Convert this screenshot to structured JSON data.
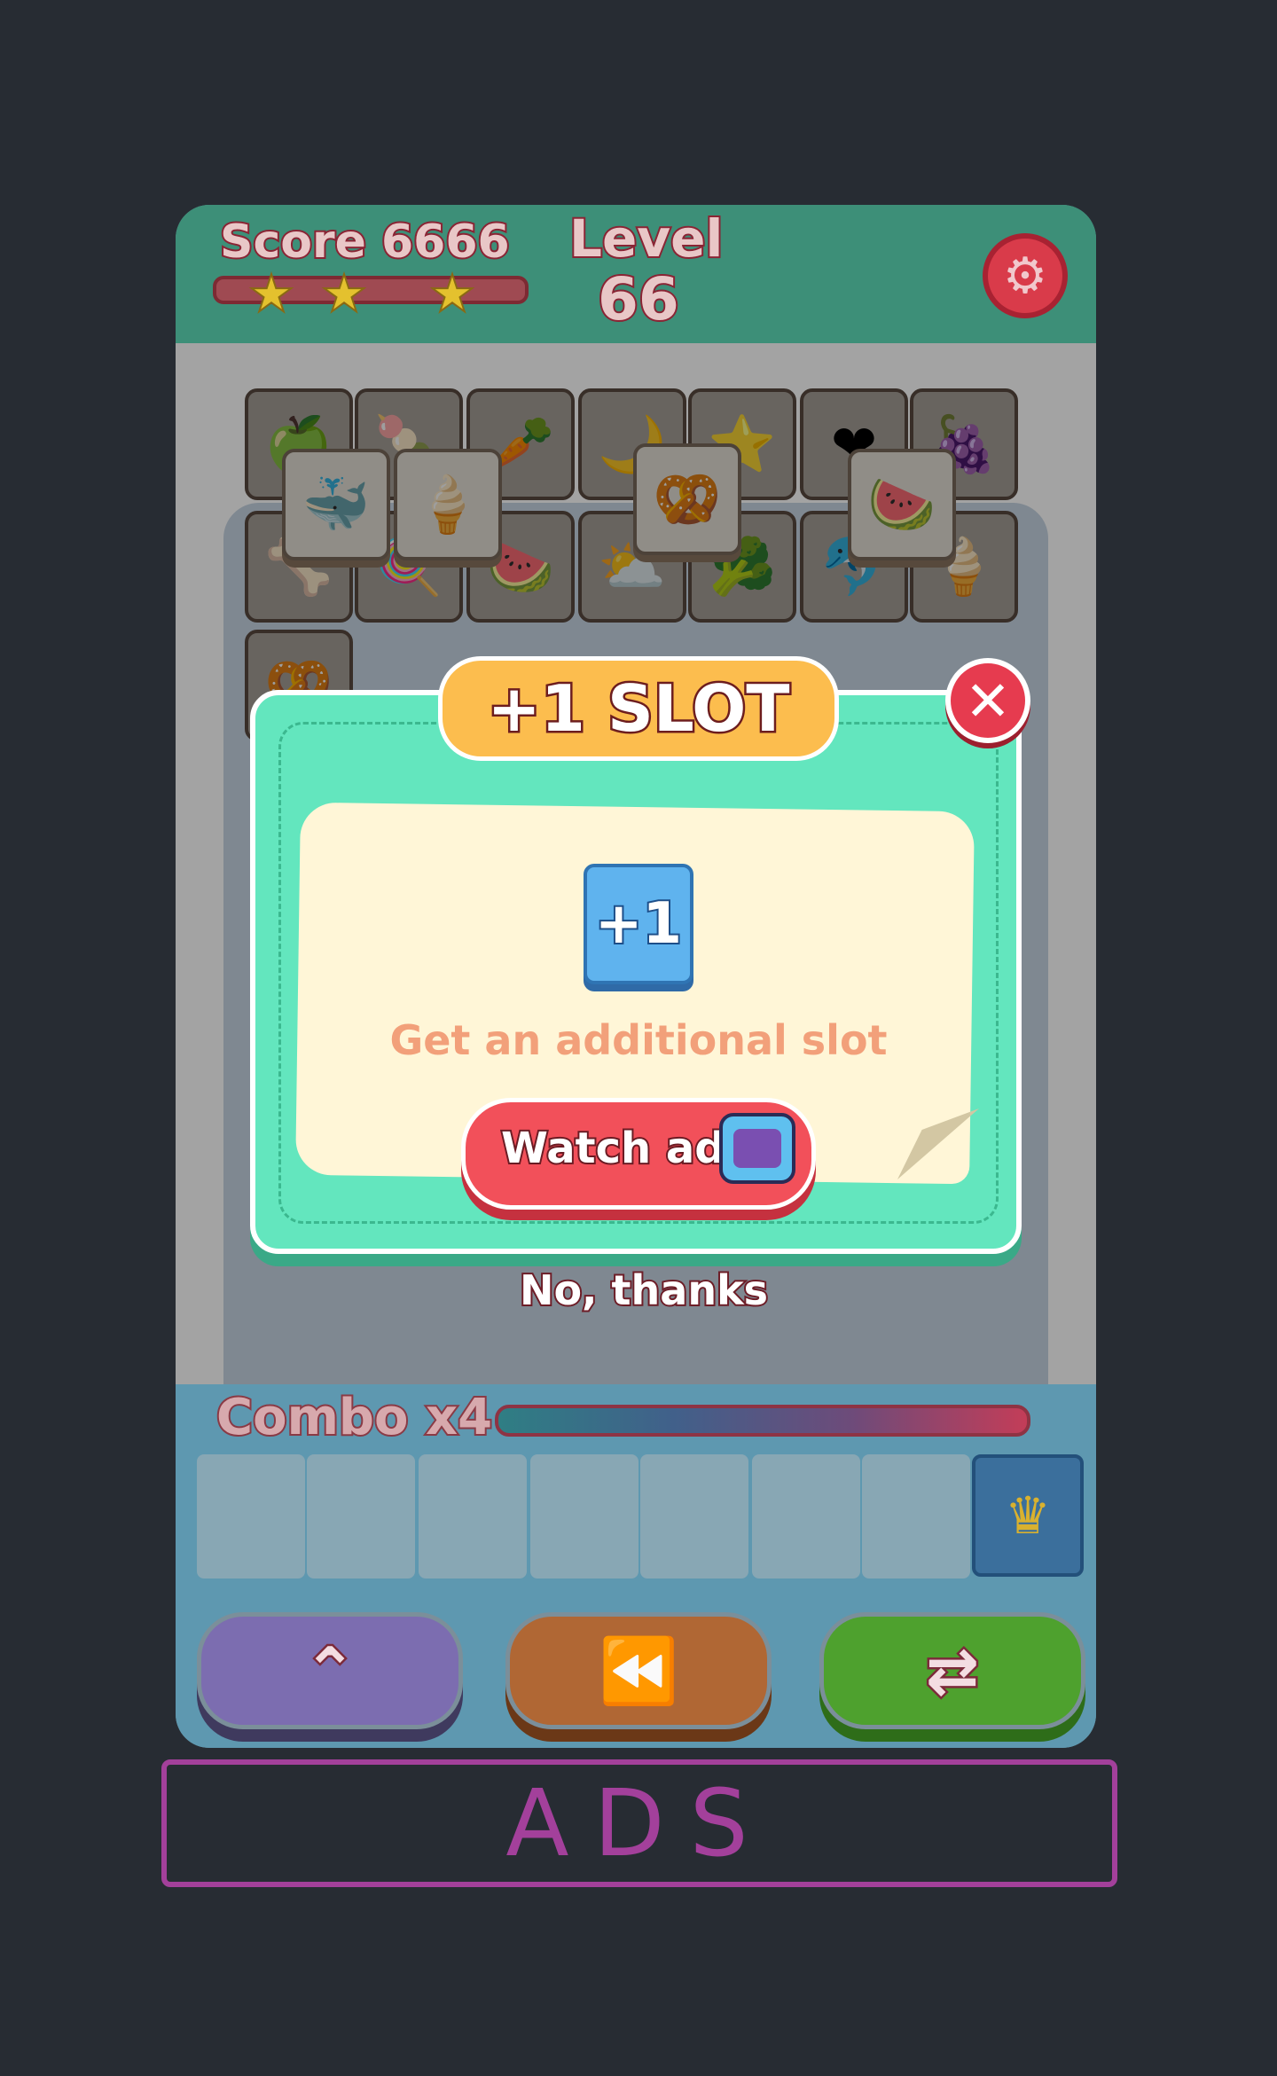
{
  "header": {
    "score_label": "Score",
    "score_value": "6666",
    "level_label": "Level",
    "level_value": "66",
    "stars_earned": 3,
    "settings_icon": "gear-icon"
  },
  "board": {
    "tiles": [
      "apple",
      "candy",
      "carrot",
      "moon",
      "star",
      "heart",
      "grapes",
      "bone",
      "lollipop",
      "watermelon",
      "cloud",
      "broccoli",
      "dolphin",
      "ice-cream",
      "pretzel"
    ],
    "top_tiles": [
      "whale",
      "ice-cream",
      "pretzel",
      "watermelon"
    ]
  },
  "dialog": {
    "title": "+1 SLOT",
    "close_icon": "close-icon",
    "reward_label": "+1",
    "description": "Get an additional slot",
    "watch_button": "Watch ads",
    "watch_icon": "tv-icon",
    "decline": "No, thanks"
  },
  "combo": {
    "label": "Combo x4"
  },
  "slots": {
    "count": 8,
    "special_icon": "crown-icon"
  },
  "powerups": [
    {
      "name": "up",
      "icon": "double-chevron-up-icon"
    },
    {
      "name": "undo",
      "icon": "rewind-icon"
    },
    {
      "name": "shuffle",
      "icon": "shuffle-icon"
    }
  ],
  "ads": {
    "label": "ADS"
  },
  "colors": {
    "header": "#3d8f78",
    "dialog": "#63e6be",
    "title_pill": "#fcbd4e",
    "watch_button": "#f2505a",
    "ads_border": "#a3409b"
  }
}
